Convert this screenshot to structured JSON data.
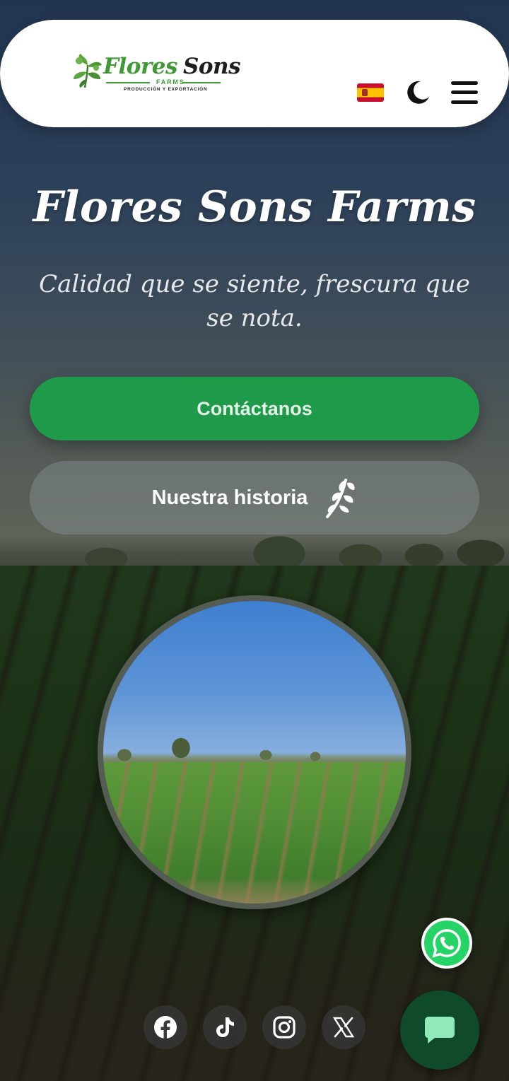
{
  "header": {
    "logo": {
      "word1": "Flores",
      "word2": "Sons",
      "farms": "FARMS",
      "tagline": "PRODUCCIÓN Y EXPORTACIÓN"
    },
    "language_flag": "spain-flag-icon",
    "theme_toggle_icon": "moon-icon",
    "menu_icon": "hamburger-menu-icon"
  },
  "hero": {
    "title": "Flores Sons Farms",
    "subtitle": "Calidad que se siente, frescura que se nota.",
    "primary_button": "Contáctanos",
    "secondary_button": "Nuestra historia",
    "secondary_button_icon": "leaf-sprig-icon"
  },
  "floating": {
    "whatsapp_icon": "whatsapp-icon",
    "chat_icon": "chat-bubble-icon"
  },
  "social": [
    {
      "name": "facebook",
      "icon": "facebook-icon"
    },
    {
      "name": "tiktok",
      "icon": "tiktok-icon"
    },
    {
      "name": "instagram",
      "icon": "instagram-icon"
    },
    {
      "name": "x",
      "icon": "x-icon"
    }
  ],
  "colors": {
    "brand_green": "#1f9a4a",
    "logo_green": "#3f9a36",
    "chat_green": "#0f4a2b",
    "whatsapp_green": "#25d366"
  }
}
